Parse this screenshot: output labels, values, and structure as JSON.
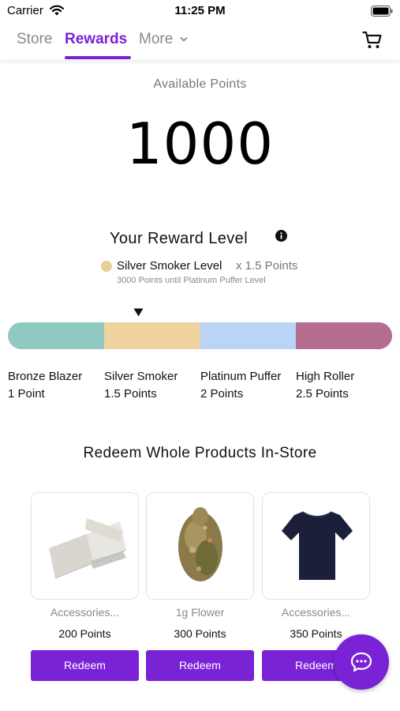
{
  "status_bar": {
    "carrier": "Carrier",
    "time": "11:25 PM"
  },
  "nav": {
    "tabs": [
      {
        "label": "Store"
      },
      {
        "label": "Rewards",
        "active": true
      },
      {
        "label": "More"
      }
    ],
    "accent_color": "#7a22d6"
  },
  "points": {
    "label": "Available Points",
    "value": "1000"
  },
  "reward_level": {
    "title": "Your Reward Level",
    "current_level": "Silver Smoker Level",
    "multiplier": "x 1.5 Points",
    "until_next": "3000 Points until Platinum Puffer Level",
    "tiers": [
      {
        "name": "Bronze Blazer",
        "points": "1 Point",
        "color": "#8fc9c2"
      },
      {
        "name": "Silver Smoker",
        "points": "1.5 Points",
        "color": "#eed39e"
      },
      {
        "name": "Platinum Puffer",
        "points": "2 Points",
        "color": "#b9d4f4"
      },
      {
        "name": "High Roller",
        "points": "2.5 Points",
        "color": "#b46c8f"
      }
    ]
  },
  "redeem": {
    "title": "Redeem Whole Products In-Store",
    "products": [
      {
        "category": "Accessories...",
        "points": "200 Points",
        "button": "Redeem",
        "icon": "rolling-papers-image"
      },
      {
        "category": "1g Flower",
        "points": "300 Points",
        "button": "Redeem",
        "icon": "flower-bud-image"
      },
      {
        "category": "Accessories...",
        "points": "350 Points",
        "button": "Redeem",
        "icon": "tshirt-image"
      }
    ]
  }
}
